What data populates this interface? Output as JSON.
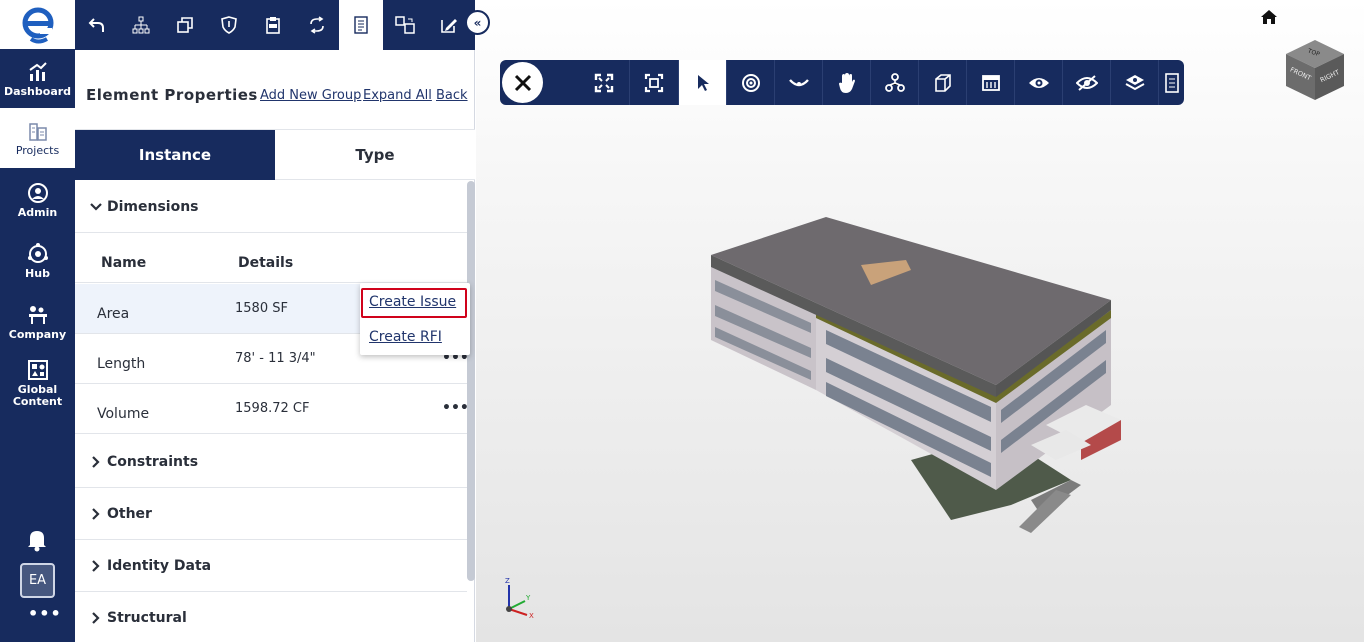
{
  "nav": {
    "items": [
      {
        "label": "Dashboard",
        "icon": "chart-icon"
      },
      {
        "label": "Projects",
        "icon": "buildings-icon"
      },
      {
        "label": "Admin",
        "icon": "admin-icon"
      },
      {
        "label": "Hub",
        "icon": "hub-icon"
      },
      {
        "label": "Company",
        "icon": "company-icon"
      },
      {
        "label": "Global Content",
        "icon": "global-content-icon"
      }
    ],
    "avatar": "EA",
    "more": "•••"
  },
  "panel": {
    "title": "Element Properties",
    "links": {
      "add_group": "Add New Group",
      "expand_all": "Expand All",
      "back": "Back"
    },
    "tabs": {
      "instance": "Instance",
      "type": "Type"
    },
    "sections": {
      "dimensions": "Dimensions",
      "constraints": "Constraints",
      "other": "Other",
      "identity": "Identity Data",
      "structural": "Structural"
    },
    "table": {
      "headers": {
        "name": "Name",
        "details": "Details"
      },
      "rows": [
        {
          "name": "Area",
          "details": "1580 SF",
          "more": "•••"
        },
        {
          "name": "Length",
          "details": "78' - 11 3/4\"",
          "more": "•••"
        },
        {
          "name": "Volume",
          "details": "1598.72 CF",
          "more": "•••"
        }
      ]
    },
    "context_menu": {
      "create_issue": "Create Issue",
      "create_rfi": "Create RFI"
    }
  },
  "viewer": {
    "cube_faces": {
      "top": "TOP",
      "front": "FRONT",
      "right": "RIGHT"
    },
    "axes": {
      "x": "X",
      "y": "Y",
      "z": "Z"
    }
  },
  "colors": {
    "navy": "#172b5e",
    "highlight": "#d0021b"
  }
}
